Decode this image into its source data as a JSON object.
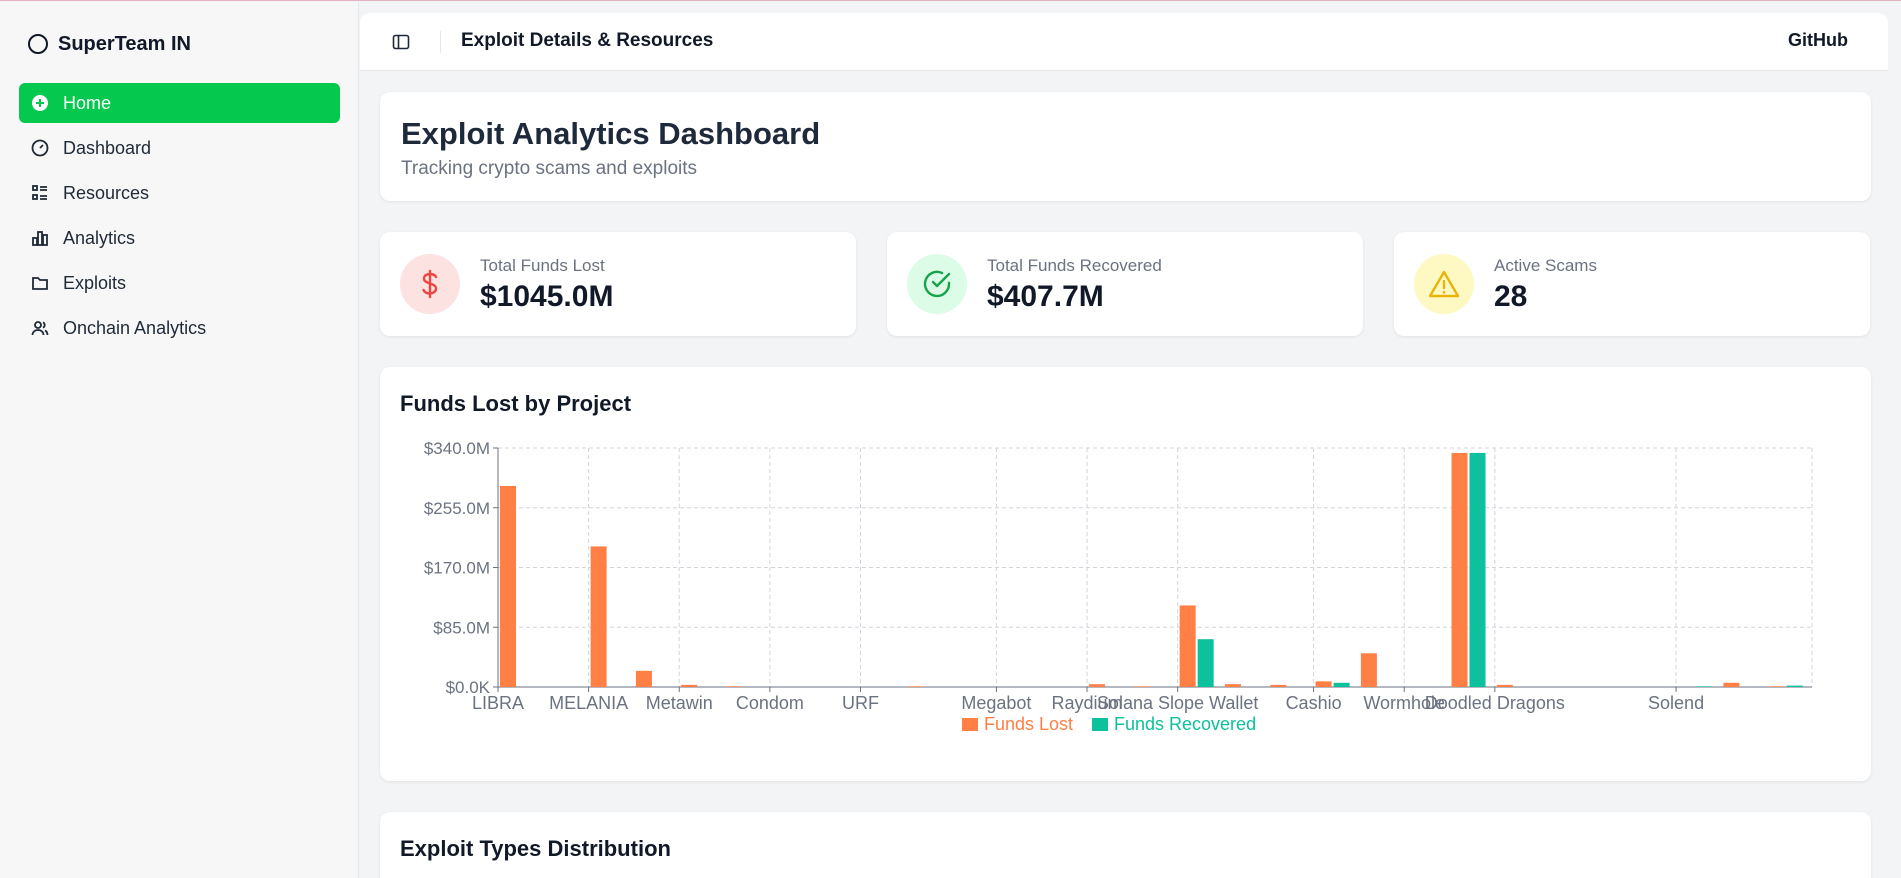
{
  "sidebar": {
    "brand": "SuperTeam IN",
    "items": [
      {
        "label": "Home",
        "icon": "plus-circle-icon",
        "active": true
      },
      {
        "label": "Dashboard",
        "icon": "gauge-icon"
      },
      {
        "label": "Resources",
        "icon": "list-icon"
      },
      {
        "label": "Analytics",
        "icon": "bar-chart-icon"
      },
      {
        "label": "Exploits",
        "icon": "folder-icon"
      },
      {
        "label": "Onchain Analytics",
        "icon": "users-icon"
      }
    ]
  },
  "topbar": {
    "title": "Exploit Details & Resources",
    "github": "GitHub",
    "toggle_icon": "sidebar-toggle-icon"
  },
  "header": {
    "title": "Exploit Analytics Dashboard",
    "subtitle": "Tracking crypto scams and exploits"
  },
  "stats": [
    {
      "label": "Total Funds Lost",
      "value": "$1045.0M",
      "icon": "dollar-icon",
      "color": "#ef4444",
      "bg": "#fde2e2"
    },
    {
      "label": "Total Funds Recovered",
      "value": "$407.7M",
      "icon": "check-circle-icon",
      "color": "#16a34a",
      "bg": "#dcfce7"
    },
    {
      "label": "Active Scams",
      "value": "28",
      "icon": "warning-icon",
      "color": "#eab308",
      "bg": "#fef9c3"
    }
  ],
  "colors": {
    "accent": "#05c84e",
    "funds_lost": "#ff7f45",
    "funds_recovered": "#0cc19c"
  },
  "chart_data": {
    "type": "bar",
    "title": "Funds Lost by Project",
    "ylim": [
      0,
      340
    ],
    "ytick_labels": [
      "$0.0K",
      "$85.0M",
      "$170.0M",
      "$255.0M",
      "$340.0M"
    ],
    "ytick_values": [
      0,
      85,
      170,
      255,
      340
    ],
    "categories": [
      "LIBRA",
      "",
      "MELANIA",
      "",
      "Metawin",
      "",
      "Condom",
      "",
      "URF",
      "",
      "",
      "Megabot",
      "",
      "Raydium",
      "",
      "Solana Slope Wallet",
      "",
      "",
      "Cashio",
      "",
      "Wormhole",
      "",
      "Doodled Dragons",
      "",
      "",
      "",
      "Solend",
      "",
      ""
    ],
    "series": [
      {
        "name": "Funds Lost",
        "values": [
          286,
          0,
          200,
          23,
          3,
          1,
          0,
          0,
          0,
          1,
          0,
          0,
          0,
          4,
          1,
          116,
          4,
          3,
          8,
          48,
          0,
          333,
          3,
          0,
          0,
          0,
          0,
          6,
          1
        ]
      },
      {
        "name": "Funds Recovered",
        "values": [
          0,
          0,
          0,
          0,
          0,
          0,
          0,
          0,
          0,
          0,
          0,
          0,
          0,
          0,
          0,
          68,
          0,
          0,
          6,
          0,
          0,
          333,
          0,
          0,
          0,
          0,
          1,
          0,
          2
        ]
      }
    ],
    "grid": true,
    "legend": "bottom-center"
  },
  "distribution": {
    "title": "Exploit Types Distribution"
  }
}
